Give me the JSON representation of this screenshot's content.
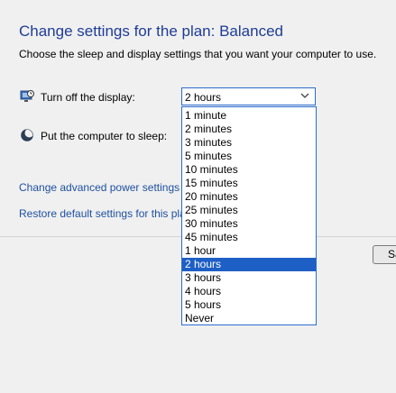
{
  "page": {
    "title": "Change settings for the plan: Balanced",
    "subtitle": "Choose the sleep and display settings that you want your computer to use."
  },
  "display_setting": {
    "label": "Turn off the display:",
    "icon": "monitor-icon",
    "selected_value": "2 hours"
  },
  "sleep_setting": {
    "label": "Put the computer to sleep:",
    "icon": "moon-icon"
  },
  "links": {
    "advanced": "Change advanced power settings",
    "restore": "Restore default settings for this pla"
  },
  "dropdown": {
    "options": [
      "1 minute",
      "2 minutes",
      "3 minutes",
      "5 minutes",
      "10 minutes",
      "15 minutes",
      "20 minutes",
      "25 minutes",
      "30 minutes",
      "45 minutes",
      "1 hour",
      "2 hours",
      "3 hours",
      "4 hours",
      "5 hours",
      "Never"
    ],
    "highlighted": "2 hours"
  },
  "buttons": {
    "save_label": "Sa"
  },
  "colors": {
    "title": "#1e3c96",
    "link": "#1e50a0",
    "highlight": "#1e5fc6",
    "focus_border": "#2b6bcf"
  }
}
